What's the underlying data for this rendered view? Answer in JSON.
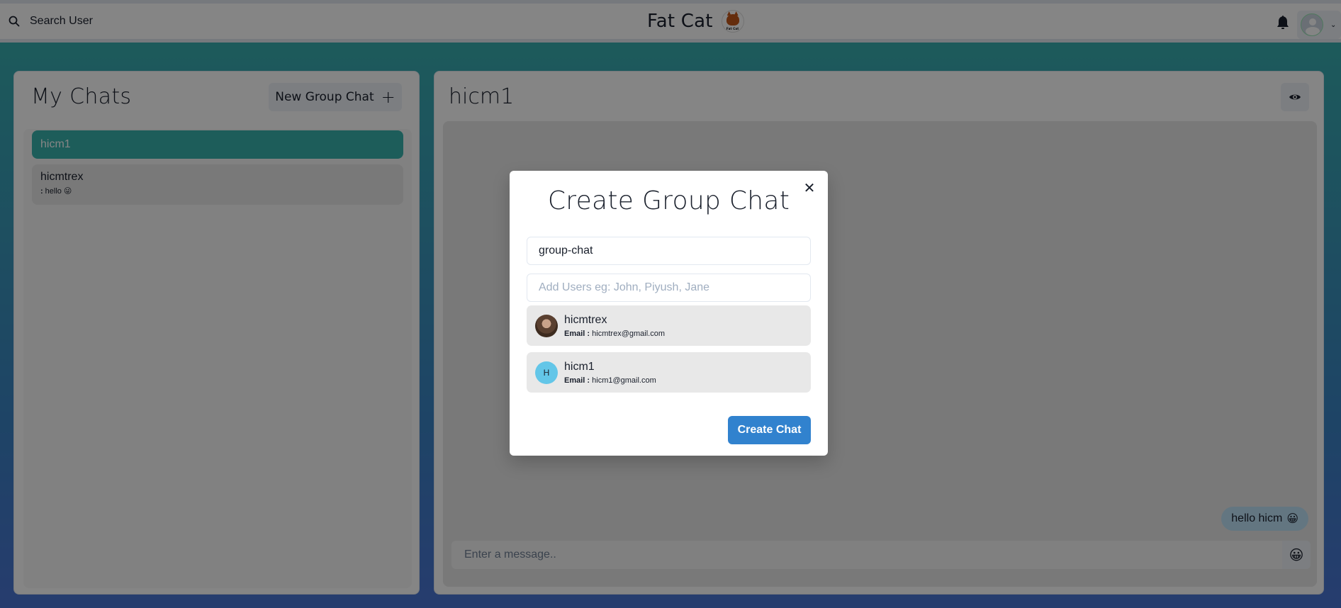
{
  "header": {
    "search_label": "Search User",
    "brand_title": "Fat Cat",
    "brand_logo_caption": "Fat Cat",
    "icons": {
      "search": "search-icon",
      "bell": "bell-icon",
      "avatar": "user-avatar-icon",
      "chevron": "chevron-down-icon"
    }
  },
  "sidebar": {
    "title": "My Chats",
    "new_group_label": "New Group Chat",
    "chats": [
      {
        "name": "hicm1",
        "active": true
      },
      {
        "name": "hicmtrex",
        "latest_prefix": ":",
        "latest_text": "hello",
        "latest_emoji": "😜"
      }
    ]
  },
  "chat": {
    "title": "hicm1",
    "messages": [
      {
        "text": "hello hicm",
        "emoji": "😀",
        "sender": "self"
      }
    ],
    "input_placeholder": "Enter a message..",
    "emoji_button": "😀"
  },
  "modal": {
    "title": "Create Group Chat",
    "close_glyph": "✕",
    "chat_name_value": "group-chat",
    "users_placeholder": "Add Users eg: John, Piyush, Jane",
    "results": [
      {
        "name": "hicmtrex",
        "email_label": "Email :",
        "email": "hicmtrex@gmail.com",
        "avatar": "photo"
      },
      {
        "name": "hicm1",
        "email_label": "Email :",
        "email": "hicm1@gmail.com",
        "avatar_initial": "H"
      }
    ],
    "submit_label": "Create Chat"
  },
  "colors": {
    "active_chat": "#38b2ac",
    "primary_button": "#3182ce",
    "bubble_self": "#bee3f8",
    "initial_avatar": "#63c6e8"
  }
}
